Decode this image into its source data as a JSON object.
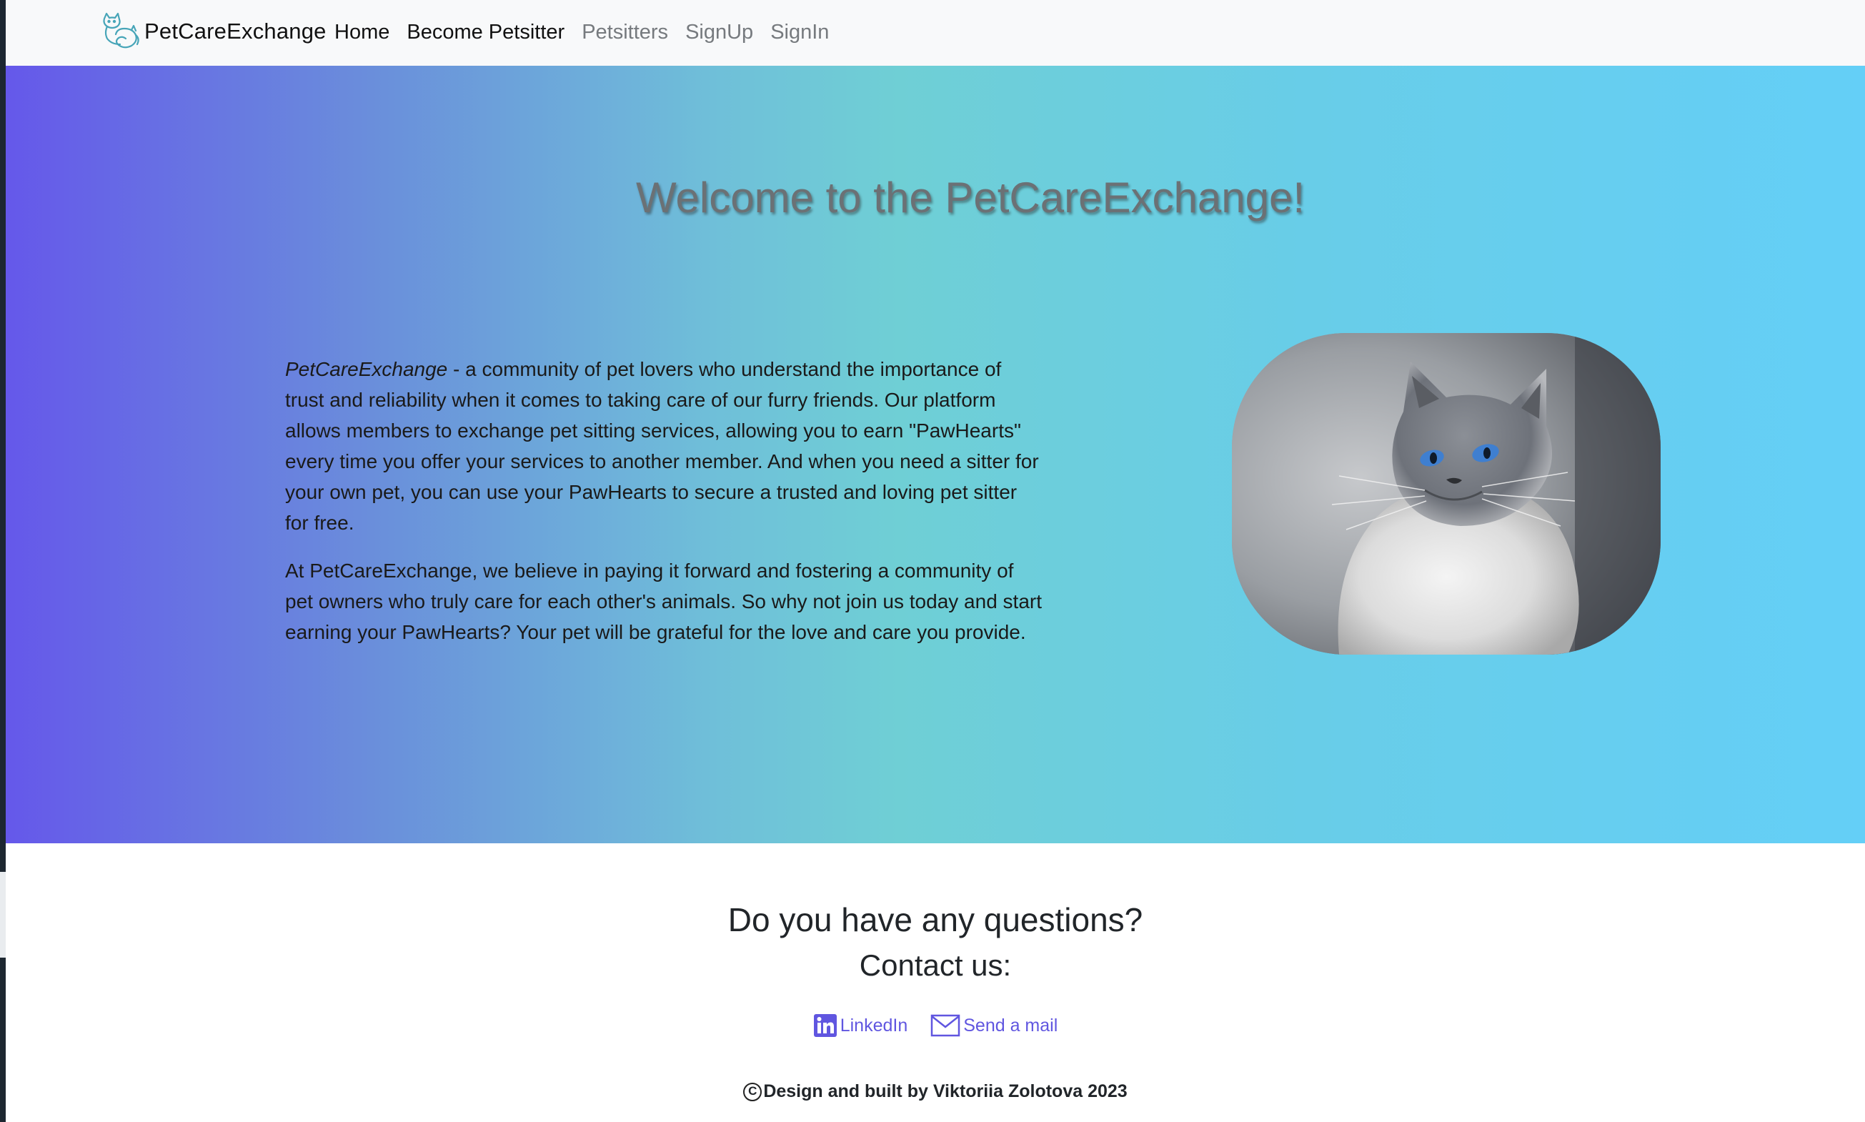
{
  "navbar": {
    "brand": {
      "logo_icon": "cat-logo-icon",
      "text": "PetCareExchange"
    },
    "links": [
      {
        "label": "Home",
        "state": "active"
      },
      {
        "label": "Become Petsitter",
        "state": "active"
      },
      {
        "label": "Petsitters",
        "state": "muted"
      },
      {
        "label": "SignUp",
        "state": "muted"
      },
      {
        "label": "SignIn",
        "state": "muted"
      }
    ]
  },
  "hero": {
    "title": "Welcome to the PetCareExchange!",
    "intro_brand": "PetCareExchange",
    "paragraph1_rest": " - a community of pet lovers who understand the importance of trust and reliability when it comes to taking care of our furry friends. Our platform allows members to exchange pet sitting services, allowing you to earn \"PawHearts\" every time you offer your services to another member. And when you need a sitter for your own pet, you can use your PawHearts to secure a trusted and loving pet sitter for free.",
    "paragraph2": "At PetCareExchange, we believe in paying it forward and fostering a community of pet owners who truly care for each other's animals. So why not join us today and start earning your PawHearts? Your pet will be grateful for the love and care you provide.",
    "image": "cat-photo",
    "gradient_colors": [
      "#6558ea",
      "#6fcfd5",
      "#64cff7"
    ]
  },
  "contact": {
    "question": "Do you have any questions?",
    "contact_us": "Contact us:",
    "links": [
      {
        "label": "LinkedIn",
        "icon": "linkedin-icon"
      },
      {
        "label": "Send a mail",
        "icon": "mail-icon"
      }
    ],
    "link_color": "#6056e0",
    "credit": "Design and built by Viktoriia Zolotova 2023",
    "credit_icon": "copyright-icon"
  }
}
